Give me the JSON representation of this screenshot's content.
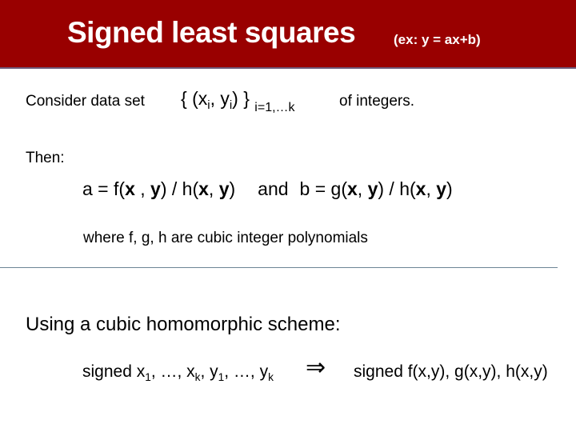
{
  "header": {
    "title": "Signed least squares",
    "subtitle": "(ex:   y = ax+b)",
    "bg_color": "#990000"
  },
  "body": {
    "consider": "Consider data set",
    "dataset": {
      "open": "{  (x",
      "i1": "i",
      "comma": ",  y",
      "i2": "i",
      "close": ")  }",
      "range": "i=1,…k"
    },
    "of_integers": "of integers.",
    "then": "Then:",
    "formula": {
      "a_part": "a = f(",
      "x1": "x",
      "c1": " , ",
      "y1": "y",
      "p1": ") / h(",
      "x2": "x",
      "c2": ", ",
      "y2": "y",
      "p2": ")",
      "and": "and",
      "b_part": "b = g(",
      "x3": "x",
      "c3": ", ",
      "y3": "y",
      "p3": ") / h(",
      "x4": "x",
      "c4": ", ",
      "y4": "y",
      "p4": ")"
    },
    "where": "where  f, g, h  are cubic integer polynomials",
    "using": "Using a cubic homomorphic scheme:",
    "signed_input": {
      "prefix": "signed  x",
      "s1": "1",
      "m1": ", …, x",
      "sk1": "k",
      "m2": ",  y",
      "s2": "1",
      "m3": ", …, y",
      "sk2": "k"
    },
    "arrow": "⇒",
    "signed_output": "signed  f(x,y), g(x,y), h(x,y)"
  }
}
